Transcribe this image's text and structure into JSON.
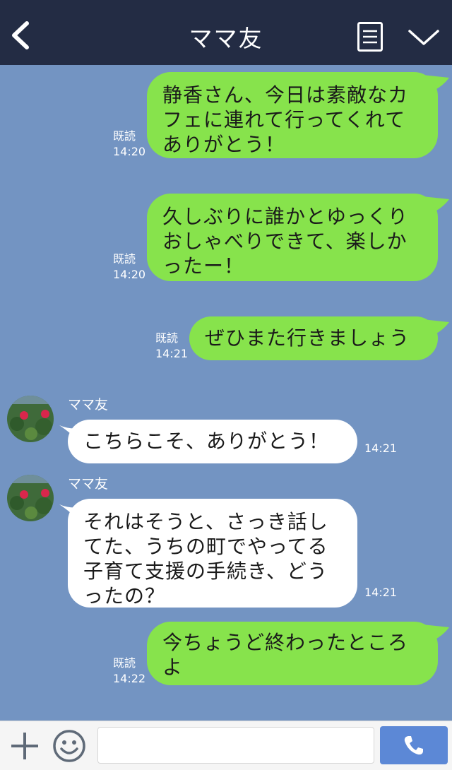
{
  "header": {
    "title": "ママ友"
  },
  "messages": [
    {
      "side": "out",
      "lines": [
        "静香さん、今日は素敵なカ",
        "フェに連れて行ってくれて",
        "ありがとう！"
      ],
      "read": "既読",
      "time": "14:20"
    },
    {
      "side": "out",
      "lines": [
        "久しぶりに誰かとゆっくり",
        "おしゃべりできて、楽しか",
        "ったー！"
      ],
      "read": "既読",
      "time": "14:20"
    },
    {
      "side": "out",
      "lines": [
        "ぜひまた行きましょう"
      ],
      "read": "既読",
      "time": "14:21"
    },
    {
      "side": "in",
      "sender": "ママ友",
      "lines": [
        "こちらこそ、ありがとう！"
      ],
      "time": "14:21"
    },
    {
      "side": "in",
      "sender": "ママ友",
      "lines": [
        "それはそうと、さっき話し",
        "てた、うちの町でやってる",
        "子育て支援の手続き、どう",
        "ったの？"
      ],
      "time": "14:21"
    },
    {
      "side": "out",
      "lines": [
        "今ちょうど終わったところ",
        "よ"
      ],
      "read": "既読",
      "time": "14:22"
    }
  ],
  "footer": {
    "input_value": ""
  },
  "colors": {
    "header_bg": "#232c44",
    "chat_bg": "#7394c2",
    "outgoing_bubble": "#87e34c",
    "incoming_bubble": "#ffffff",
    "send_button": "#5c88d6"
  },
  "icons": [
    "back-arrow-icon",
    "menu-list-icon",
    "chevron-down-icon",
    "plus-icon",
    "emoji-smile-icon",
    "phone-icon"
  ]
}
